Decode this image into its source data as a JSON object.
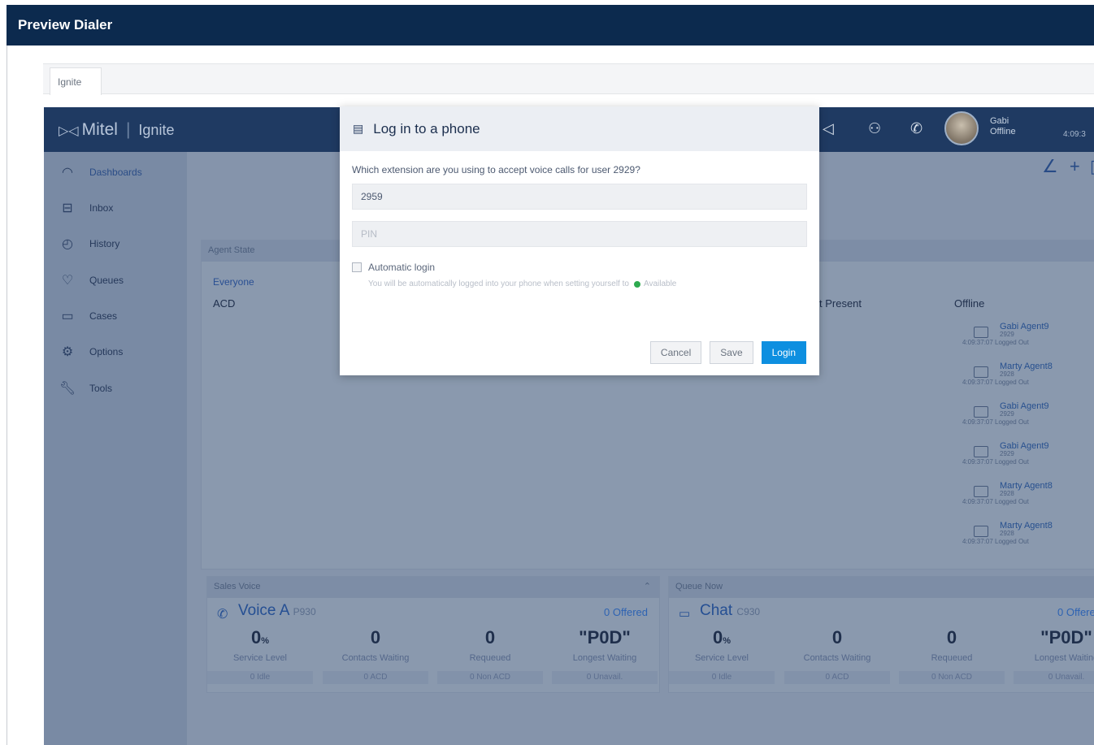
{
  "window": {
    "title": "Preview Dialer"
  },
  "tabs": [
    {
      "label": "Ignite"
    }
  ],
  "appbar": {
    "brand": "Mitel",
    "product": "Ignite",
    "user_name": "Gabi",
    "user_status": "Offline",
    "clock": "4:09:3"
  },
  "sidebar": {
    "items": [
      {
        "label": "Dashboards",
        "icon": "dashboard-icon"
      },
      {
        "label": "Inbox",
        "icon": "inbox-icon"
      },
      {
        "label": "History",
        "icon": "history-icon"
      },
      {
        "label": "Queues",
        "icon": "queues-icon"
      },
      {
        "label": "Cases",
        "icon": "cases-icon"
      },
      {
        "label": "Options",
        "icon": "gear-icon"
      },
      {
        "label": "Tools",
        "icon": "wrench-icon"
      }
    ]
  },
  "agent_state": {
    "header": "Agent State",
    "filter": "Everyone",
    "group": "ACD",
    "present_label": "t Present",
    "offline_label": "Offline",
    "offline_agents": [
      {
        "name": "Gabi Agent9",
        "ext": "2929",
        "status": "4:09:37:07 Logged Out"
      },
      {
        "name": "Marty Agent8",
        "ext": "2928",
        "status": "4:09:37:07 Logged Out"
      },
      {
        "name": "Gabi Agent9",
        "ext": "2929",
        "status": "4:09:37:07 Logged Out"
      },
      {
        "name": "Gabi Agent9",
        "ext": "2929",
        "status": "4:09:37:07 Logged Out"
      },
      {
        "name": "Marty Agent8",
        "ext": "2928",
        "status": "4:09:37:07 Logged Out"
      },
      {
        "name": "Marty Agent8",
        "ext": "2928",
        "status": "4:09:37:07 Logged Out"
      }
    ]
  },
  "queues": [
    {
      "header": "Sales Voice",
      "title": "Voice A",
      "code": "P930",
      "offered": "0 Offered",
      "metrics": [
        {
          "value": "0",
          "unit": "%",
          "label": "Service Level",
          "footer": "0 Idle"
        },
        {
          "value": "0",
          "unit": "",
          "label": "Contacts Waiting",
          "footer": "0 ACD"
        },
        {
          "value": "0",
          "unit": "",
          "label": "Requeued",
          "footer": "0 Non ACD"
        },
        {
          "value": "\"P0D\"",
          "unit": "",
          "label": "Longest Waiting",
          "footer": "0 Unavail."
        }
      ]
    },
    {
      "header": "Queue Now",
      "title": "Chat",
      "code": "C930",
      "offered": "0 Offere",
      "metrics": [
        {
          "value": "0",
          "unit": "%",
          "label": "Service Level",
          "footer": "0 Idle"
        },
        {
          "value": "0",
          "unit": "",
          "label": "Contacts Waiting",
          "footer": "0 ACD"
        },
        {
          "value": "0",
          "unit": "",
          "label": "Requeued",
          "footer": "0 Non ACD"
        },
        {
          "value": "\"P0D\"",
          "unit": "",
          "label": "Longest Waiting",
          "footer": "0 Unavail."
        }
      ]
    }
  ],
  "modal": {
    "title": "Log in to a phone",
    "question": "Which extension are you using to accept voice calls for user 2929?",
    "extension_value": "2959",
    "pin_placeholder": "PIN",
    "auto_login_label": "Automatic login",
    "hint_text": "You will be automatically logged into your phone when setting yourself to",
    "hint_status": "Available",
    "cancel_label": "Cancel",
    "save_label": "Save",
    "login_label": "Login"
  }
}
